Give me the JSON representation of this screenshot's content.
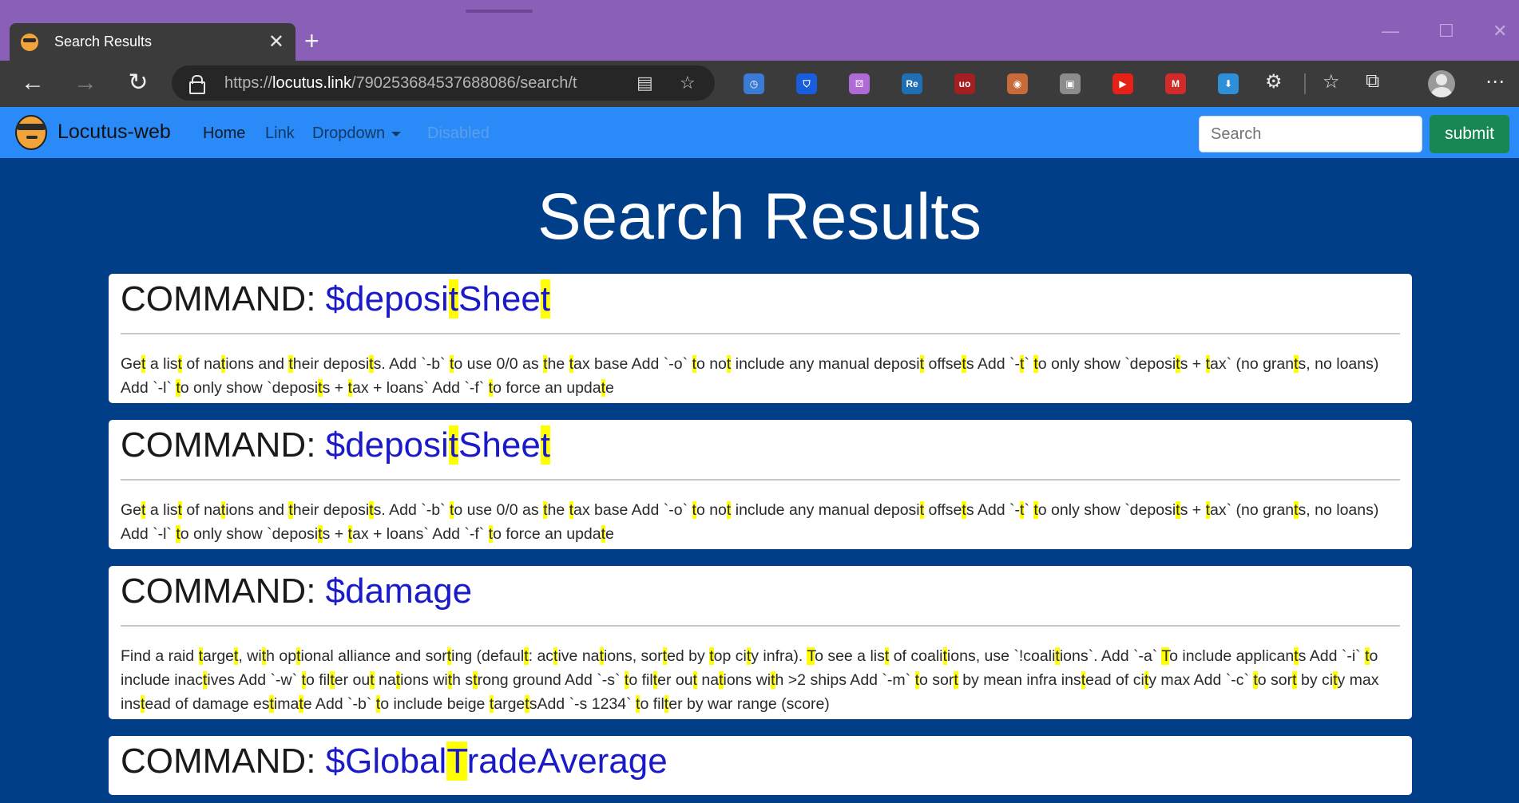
{
  "browser": {
    "tab_title": "Search Results",
    "url_prefix": "https://",
    "url_host": "locutus.link",
    "url_path": "/790253684537688086/search/t",
    "extensions": [
      {
        "name": "clock-extension",
        "color": "#3a7bd5",
        "label": "◷"
      },
      {
        "name": "bitwarden-extension",
        "color": "#175ddc",
        "label": "⛉"
      },
      {
        "name": "dice-extension",
        "color": "#b06ad8",
        "label": "⚄"
      },
      {
        "name": "re-extension",
        "color": "#1f6fb5",
        "label": "Re"
      },
      {
        "name": "ublock-extension",
        "color": "#a41e22",
        "label": "uo"
      },
      {
        "name": "owl-extension",
        "color": "#c86b3a",
        "label": "◉"
      },
      {
        "name": "gray-extension",
        "color": "#8c8c8c",
        "label": "▣"
      },
      {
        "name": "youtube-extension",
        "color": "#e62117",
        "label": "▶"
      },
      {
        "name": "m-extension",
        "color": "#d22b2b",
        "label": "M"
      },
      {
        "name": "download-extension",
        "color": "#2d8fd8",
        "label": "⬇"
      }
    ]
  },
  "navbar": {
    "brand": "Locutus-web",
    "links": {
      "home": "Home",
      "link": "Link",
      "dropdown": "Dropdown",
      "disabled": "Disabled"
    },
    "search_placeholder": "Search",
    "submit_label": "submit"
  },
  "page": {
    "title": "Search Results",
    "command_prefix": "COMMAND: ",
    "highlight_color": "#ffff00"
  },
  "results": [
    {
      "command": [
        {
          "t": "$deposi"
        },
        {
          "t": "t",
          "h": true
        },
        {
          "t": "Shee"
        },
        {
          "t": "t",
          "h": true
        }
      ],
      "description": [
        {
          "t": "Ge"
        },
        {
          "t": "t",
          "h": true
        },
        {
          "t": " a lis"
        },
        {
          "t": "t",
          "h": true
        },
        {
          "t": " of na"
        },
        {
          "t": "t",
          "h": true
        },
        {
          "t": "ions and "
        },
        {
          "t": "t",
          "h": true
        },
        {
          "t": "heir deposi"
        },
        {
          "t": "t",
          "h": true
        },
        {
          "t": "s. Add `-b` "
        },
        {
          "t": "t",
          "h": true
        },
        {
          "t": "o use 0/0 as "
        },
        {
          "t": "t",
          "h": true
        },
        {
          "t": "he "
        },
        {
          "t": "t",
          "h": true
        },
        {
          "t": "ax base Add `-o` "
        },
        {
          "t": "t",
          "h": true
        },
        {
          "t": "o no"
        },
        {
          "t": "t",
          "h": true
        },
        {
          "t": " include any manual deposi"
        },
        {
          "t": "t",
          "h": true
        },
        {
          "t": " offse"
        },
        {
          "t": "t",
          "h": true
        },
        {
          "t": "s Add `-"
        },
        {
          "t": "t",
          "h": true
        },
        {
          "t": "` "
        },
        {
          "t": "t",
          "h": true
        },
        {
          "t": "o only show `deposi"
        },
        {
          "t": "t",
          "h": true
        },
        {
          "t": "s + "
        },
        {
          "t": "t",
          "h": true
        },
        {
          "t": "ax` (no gran"
        },
        {
          "t": "t",
          "h": true
        },
        {
          "t": "s, no loans) Add `-l` "
        },
        {
          "t": "t",
          "h": true
        },
        {
          "t": "o only show `deposi"
        },
        {
          "t": "t",
          "h": true
        },
        {
          "t": "s + "
        },
        {
          "t": "t",
          "h": true
        },
        {
          "t": "ax + loans` Add `-f` "
        },
        {
          "t": "t",
          "h": true
        },
        {
          "t": "o force an upda"
        },
        {
          "t": "t",
          "h": true
        },
        {
          "t": "e"
        }
      ]
    },
    {
      "command": [
        {
          "t": "$deposi"
        },
        {
          "t": "t",
          "h": true
        },
        {
          "t": "Shee"
        },
        {
          "t": "t",
          "h": true
        }
      ],
      "description": [
        {
          "t": "Ge"
        },
        {
          "t": "t",
          "h": true
        },
        {
          "t": " a lis"
        },
        {
          "t": "t",
          "h": true
        },
        {
          "t": " of na"
        },
        {
          "t": "t",
          "h": true
        },
        {
          "t": "ions and "
        },
        {
          "t": "t",
          "h": true
        },
        {
          "t": "heir deposi"
        },
        {
          "t": "t",
          "h": true
        },
        {
          "t": "s. Add `-b` "
        },
        {
          "t": "t",
          "h": true
        },
        {
          "t": "o use 0/0 as "
        },
        {
          "t": "t",
          "h": true
        },
        {
          "t": "he "
        },
        {
          "t": "t",
          "h": true
        },
        {
          "t": "ax base Add `-o` "
        },
        {
          "t": "t",
          "h": true
        },
        {
          "t": "o no"
        },
        {
          "t": "t",
          "h": true
        },
        {
          "t": " include any manual deposi"
        },
        {
          "t": "t",
          "h": true
        },
        {
          "t": " offse"
        },
        {
          "t": "t",
          "h": true
        },
        {
          "t": "s Add `-"
        },
        {
          "t": "t",
          "h": true
        },
        {
          "t": "` "
        },
        {
          "t": "t",
          "h": true
        },
        {
          "t": "o only show `deposi"
        },
        {
          "t": "t",
          "h": true
        },
        {
          "t": "s + "
        },
        {
          "t": "t",
          "h": true
        },
        {
          "t": "ax` (no gran"
        },
        {
          "t": "t",
          "h": true
        },
        {
          "t": "s, no loans) Add `-l` "
        },
        {
          "t": "t",
          "h": true
        },
        {
          "t": "o only show `deposi"
        },
        {
          "t": "t",
          "h": true
        },
        {
          "t": "s + "
        },
        {
          "t": "t",
          "h": true
        },
        {
          "t": "ax + loans` Add `-f` "
        },
        {
          "t": "t",
          "h": true
        },
        {
          "t": "o force an upda"
        },
        {
          "t": "t",
          "h": true
        },
        {
          "t": "e"
        }
      ]
    },
    {
      "command": [
        {
          "t": "$damage"
        }
      ],
      "description": [
        {
          "t": "Find a raid "
        },
        {
          "t": "t",
          "h": true
        },
        {
          "t": "arge"
        },
        {
          "t": "t",
          "h": true
        },
        {
          "t": ", wi"
        },
        {
          "t": "t",
          "h": true
        },
        {
          "t": "h op"
        },
        {
          "t": "t",
          "h": true
        },
        {
          "t": "ional alliance and sor"
        },
        {
          "t": "t",
          "h": true
        },
        {
          "t": "ing (defaul"
        },
        {
          "t": "t",
          "h": true
        },
        {
          "t": ": ac"
        },
        {
          "t": "t",
          "h": true
        },
        {
          "t": "ive na"
        },
        {
          "t": "t",
          "h": true
        },
        {
          "t": "ions, sor"
        },
        {
          "t": "t",
          "h": true
        },
        {
          "t": "ed by "
        },
        {
          "t": "t",
          "h": true
        },
        {
          "t": "op ci"
        },
        {
          "t": "t",
          "h": true
        },
        {
          "t": "y infra). "
        },
        {
          "t": "T",
          "h": true
        },
        {
          "t": "o see a lis"
        },
        {
          "t": "t",
          "h": true
        },
        {
          "t": " of coali"
        },
        {
          "t": "t",
          "h": true
        },
        {
          "t": "ions, use `!coali"
        },
        {
          "t": "t",
          "h": true
        },
        {
          "t": "ions`. Add `-a` "
        },
        {
          "t": "T",
          "h": true
        },
        {
          "t": "o include applican"
        },
        {
          "t": "t",
          "h": true
        },
        {
          "t": "s Add `-i` "
        },
        {
          "t": "t",
          "h": true
        },
        {
          "t": "o include inac"
        },
        {
          "t": "t",
          "h": true
        },
        {
          "t": "ives Add `-w` "
        },
        {
          "t": "t",
          "h": true
        },
        {
          "t": "o fil"
        },
        {
          "t": "t",
          "h": true
        },
        {
          "t": "er ou"
        },
        {
          "t": "t",
          "h": true
        },
        {
          "t": " na"
        },
        {
          "t": "t",
          "h": true
        },
        {
          "t": "ions wi"
        },
        {
          "t": "t",
          "h": true
        },
        {
          "t": "h s"
        },
        {
          "t": "t",
          "h": true
        },
        {
          "t": "rong ground Add `-s` "
        },
        {
          "t": "t",
          "h": true
        },
        {
          "t": "o fil"
        },
        {
          "t": "t",
          "h": true
        },
        {
          "t": "er ou"
        },
        {
          "t": "t",
          "h": true
        },
        {
          "t": " na"
        },
        {
          "t": "t",
          "h": true
        },
        {
          "t": "ions wi"
        },
        {
          "t": "t",
          "h": true
        },
        {
          "t": "h >2 ships Add `-m` "
        },
        {
          "t": "t",
          "h": true
        },
        {
          "t": "o sor"
        },
        {
          "t": "t",
          "h": true
        },
        {
          "t": " by mean infra ins"
        },
        {
          "t": "t",
          "h": true
        },
        {
          "t": "ead of ci"
        },
        {
          "t": "t",
          "h": true
        },
        {
          "t": "y max Add `-c` "
        },
        {
          "t": "t",
          "h": true
        },
        {
          "t": "o sor"
        },
        {
          "t": "t",
          "h": true
        },
        {
          "t": " by ci"
        },
        {
          "t": "t",
          "h": true
        },
        {
          "t": "y max ins"
        },
        {
          "t": "t",
          "h": true
        },
        {
          "t": "ead of damage es"
        },
        {
          "t": "t",
          "h": true
        },
        {
          "t": "ima"
        },
        {
          "t": "t",
          "h": true
        },
        {
          "t": "e Add `-b` "
        },
        {
          "t": "t",
          "h": true
        },
        {
          "t": "o include beige "
        },
        {
          "t": "t",
          "h": true
        },
        {
          "t": "arge"
        },
        {
          "t": "t",
          "h": true
        },
        {
          "t": "sAdd `-s 1234` "
        },
        {
          "t": "t",
          "h": true
        },
        {
          "t": "o fil"
        },
        {
          "t": "t",
          "h": true
        },
        {
          "t": "er by war range (score)"
        }
      ]
    },
    {
      "command": [
        {
          "t": "$Global"
        },
        {
          "t": "T",
          "h": true
        },
        {
          "t": "radeAverage"
        }
      ],
      "description": []
    }
  ]
}
